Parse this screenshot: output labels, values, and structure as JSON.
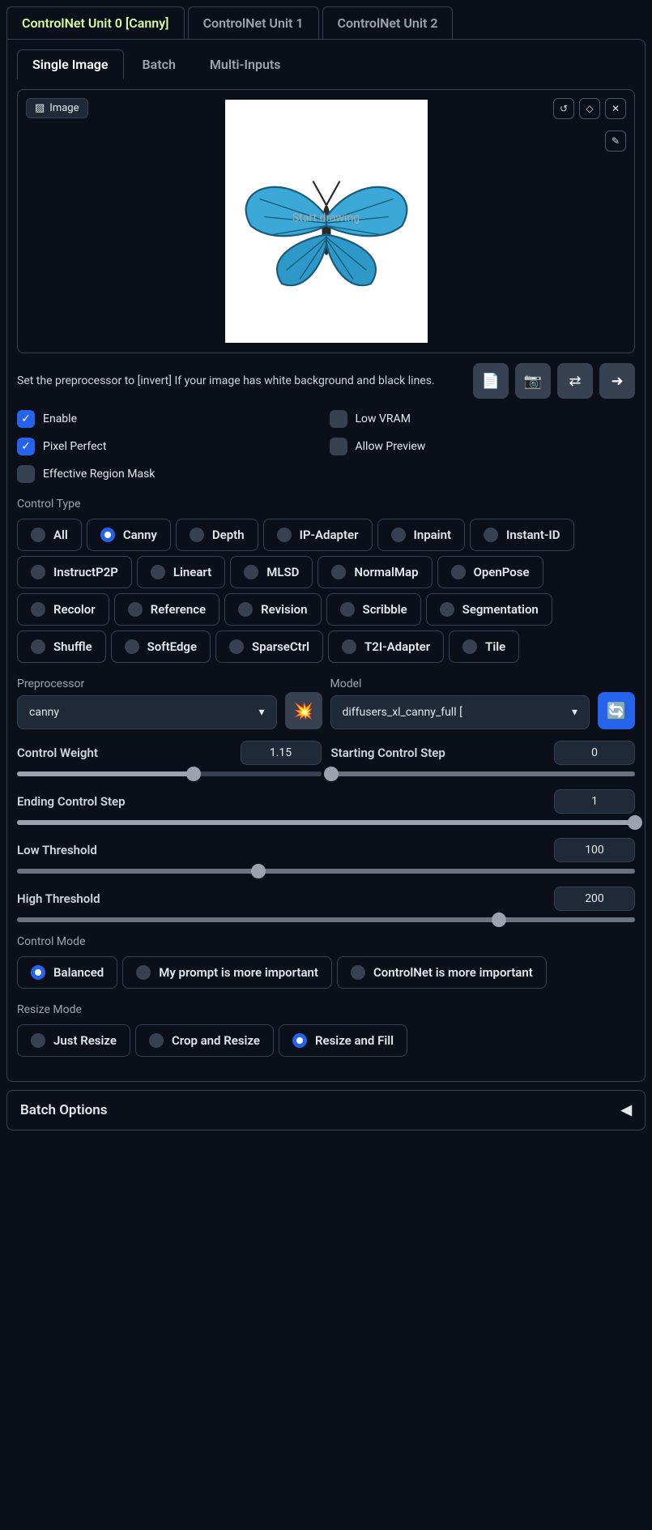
{
  "unit_tabs": [
    "ControlNet Unit 0 [Canny]",
    "ControlNet Unit 1",
    "ControlNet Unit 2"
  ],
  "sub_tabs": [
    "Single Image",
    "Batch",
    "Multi-Inputs"
  ],
  "image_chip_label": "Image",
  "image_watermark": "Start drawing",
  "hint_text": "Set the preprocessor to [invert] If your image has white background and black lines.",
  "checkboxes": {
    "enable": "Enable",
    "low_vram": "Low VRAM",
    "pixel_perfect": "Pixel Perfect",
    "allow_preview": "Allow Preview",
    "effective_region_mask": "Effective Region Mask"
  },
  "control_type_label": "Control Type",
  "control_types": [
    "All",
    "Canny",
    "Depth",
    "IP-Adapter",
    "Inpaint",
    "Instant-ID",
    "InstructP2P",
    "Lineart",
    "MLSD",
    "NormalMap",
    "OpenPose",
    "Recolor",
    "Reference",
    "Revision",
    "Scribble",
    "Segmentation",
    "Shuffle",
    "SoftEdge",
    "SparseCtrl",
    "T2I-Adapter",
    "Tile"
  ],
  "control_type_selected": "Canny",
  "preprocessor_label": "Preprocessor",
  "preprocessor_value": "canny",
  "model_label": "Model",
  "model_value": "diffusers_xl_canny_full [",
  "sliders": {
    "control_weight": {
      "label": "Control Weight",
      "value": "1.15",
      "pct": 58
    },
    "starting_step": {
      "label": "Starting Control Step",
      "value": "0",
      "pct": 0
    },
    "ending_step": {
      "label": "Ending Control Step",
      "value": "1",
      "pct": 100
    },
    "low_threshold": {
      "label": "Low Threshold",
      "value": "100",
      "pct": 39
    },
    "high_threshold": {
      "label": "High Threshold",
      "value": "200",
      "pct": 78
    }
  },
  "control_mode_label": "Control Mode",
  "control_modes": [
    "Balanced",
    "My prompt is more important",
    "ControlNet is more important"
  ],
  "control_mode_selected": "Balanced",
  "resize_mode_label": "Resize Mode",
  "resize_modes": [
    "Just Resize",
    "Crop and Resize",
    "Resize and Fill"
  ],
  "resize_mode_selected": "Resize and Fill",
  "batch_options_label": "Batch Options"
}
